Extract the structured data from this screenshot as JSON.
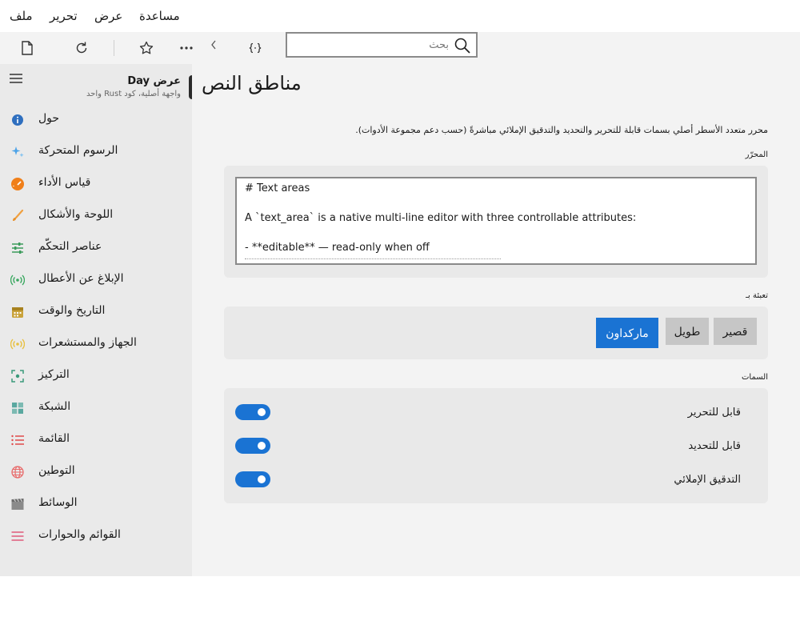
{
  "menu": {
    "file": "ملف",
    "edit": "تحرير",
    "view": "عرض",
    "help": "مساعدة"
  },
  "toolbar": {
    "search_placeholder": "بحث",
    "icons": [
      "new-document-icon",
      "refresh-icon",
      "star-icon",
      "more-icon",
      "chevron-left-icon",
      "code-braces-icon",
      "search-icon"
    ]
  },
  "sidebar": {
    "title": "عرض Day",
    "subtitle": "واجهة أصلية، كود Rust واحد",
    "items": [
      {
        "label": "حول",
        "icon": "info-icon",
        "color": "#2f6fbf"
      },
      {
        "label": "الرسوم المتحركة",
        "icon": "sparkle-icon",
        "color": "#4da3e8"
      },
      {
        "label": "قياس الأداء",
        "icon": "gauge-icon",
        "color": "#f07f1a"
      },
      {
        "label": "اللوحة والأشكال",
        "icon": "brush-icon",
        "color": "#f0a040"
      },
      {
        "label": "عناصر التحكّم",
        "icon": "sliders-icon",
        "color": "#3a9a5a"
      },
      {
        "label": "الإبلاغ عن الأعطال",
        "icon": "broadcast-icon",
        "color": "#3aa860"
      },
      {
        "label": "التاريخ والوقت",
        "icon": "calendar-icon",
        "color": "#c9a23a"
      },
      {
        "label": "الجهاز والمستشعرات",
        "icon": "sensor-icon",
        "color": "#e8c040"
      },
      {
        "label": "التركيز",
        "icon": "focus-icon",
        "color": "#3a9a7a"
      },
      {
        "label": "الشبكة",
        "icon": "grid-icon",
        "color": "#5aa8a0"
      },
      {
        "label": "القائمة",
        "icon": "list-icon",
        "color": "#e04a4a"
      },
      {
        "label": "التوطين",
        "icon": "globe-icon",
        "color": "#e86a6a"
      },
      {
        "label": "الوسائط",
        "icon": "clapper-icon",
        "color": "#8a8a8a"
      },
      {
        "label": "القوائم والحوارات",
        "icon": "menu-dialog-icon",
        "color": "#e05a7a"
      }
    ]
  },
  "main": {
    "title": "مناطق النص",
    "description": "محرر متعدد الأسطر أصلي بسمات قابلة للتحرير والتحديد والتدقيق الإملائي مباشرةً (حسب دعم مجموعة الأدوات).",
    "editor_label": "المحرّر",
    "editor_lines": [
      "# Text areas",
      "",
      "A `text_area` is a native multi-line editor with three controllable attributes:",
      "",
      "- **editable** — read-only when off"
    ],
    "fill_label": "تعبئة بـ",
    "fill_buttons": {
      "short": "قصير",
      "long": "طويل",
      "markdown": "ماركداون"
    },
    "attributes_label": "السمات",
    "toggles": [
      {
        "label": "قابل للتحرير",
        "on": true
      },
      {
        "label": "قابل للتحديد",
        "on": true
      },
      {
        "label": "التدقيق الإملائي",
        "on": true
      }
    ],
    "accent_color": "#1a73d3"
  }
}
